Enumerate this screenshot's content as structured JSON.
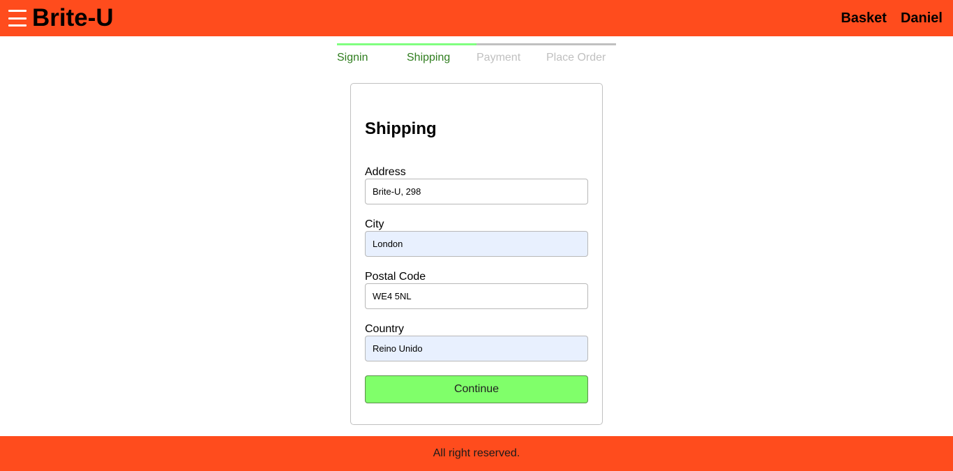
{
  "header": {
    "brand": "Brite-U",
    "links": [
      {
        "label": "Basket"
      },
      {
        "label": "Daniel"
      }
    ]
  },
  "steps": [
    {
      "label": "Signin",
      "active": true
    },
    {
      "label": "Shipping",
      "active": true
    },
    {
      "label": "Payment",
      "active": false
    },
    {
      "label": "Place Order",
      "active": false
    }
  ],
  "form": {
    "title": "Shipping",
    "fields": [
      {
        "label": "Address",
        "value": "Brite-U, 298"
      },
      {
        "label": "City",
        "value": "London"
      },
      {
        "label": "Postal Code",
        "value": "WE4 5NL"
      },
      {
        "label": "Country",
        "value": "Reino Unido"
      }
    ],
    "submit_label": "Continue"
  },
  "footer": {
    "text": "All right reserved."
  },
  "colors": {
    "brand": "#ff4c1d",
    "step_active": "#80ff80",
    "step_active_text": "#2f7d1e",
    "step_inactive": "#c0c0c0",
    "button": "#80ff6a",
    "autofill": "#e8f0fe"
  }
}
